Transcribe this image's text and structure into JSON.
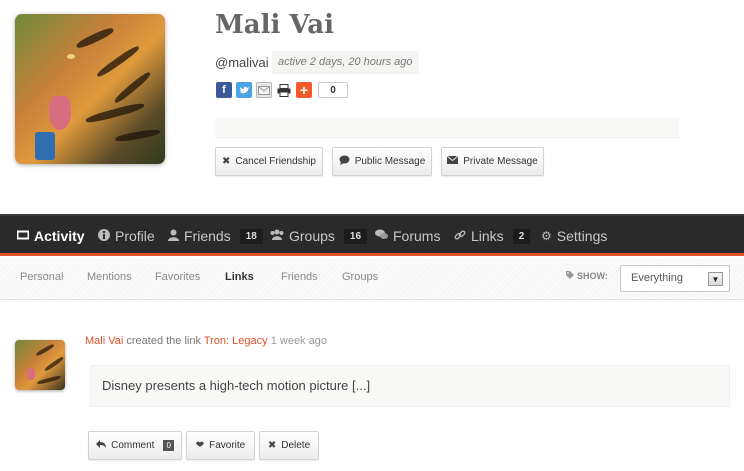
{
  "profile": {
    "name": "Mali Vai",
    "handle": "@malivai",
    "activity": "active 2 days, 20 hours ago",
    "share_count": "0",
    "buttons": {
      "cancel_friendship": "Cancel Friendship",
      "public_message": "Public Message",
      "private_message": "Private Message"
    }
  },
  "nav": {
    "items": [
      {
        "label": "Activity",
        "icon": "activity-icon"
      },
      {
        "label": "Profile",
        "icon": "info-icon"
      },
      {
        "label": "Friends",
        "icon": "person-icon",
        "count": "18"
      },
      {
        "label": "Groups",
        "icon": "group-icon",
        "count": "16"
      },
      {
        "label": "Forums",
        "icon": "chat-bubbles-icon"
      },
      {
        "label": "Links",
        "icon": "link-icon",
        "count": "2"
      },
      {
        "label": "Settings",
        "icon": "gear-icon"
      }
    ]
  },
  "subnav": {
    "items": [
      "Personal",
      "Mentions",
      "Favorites",
      "Links",
      "Friends",
      "Groups"
    ],
    "active": "Links",
    "show_label": "SHOW:",
    "filter_value": "Everything"
  },
  "activity": {
    "user": "Mali Vai",
    "action": "created the link",
    "link_title": "Tron: Legacy",
    "time": "1 week ago",
    "excerpt": "Disney presents a high-tech motion picture [...]",
    "buttons": {
      "comment": "Comment",
      "comment_count": "0",
      "favorite": "Favorite",
      "delete": "Delete"
    }
  },
  "colors": {
    "accent": "#e2522c",
    "navbar": "#2a2a2a",
    "facebook": "#3b5998",
    "twitter": "#4ba6e3"
  }
}
